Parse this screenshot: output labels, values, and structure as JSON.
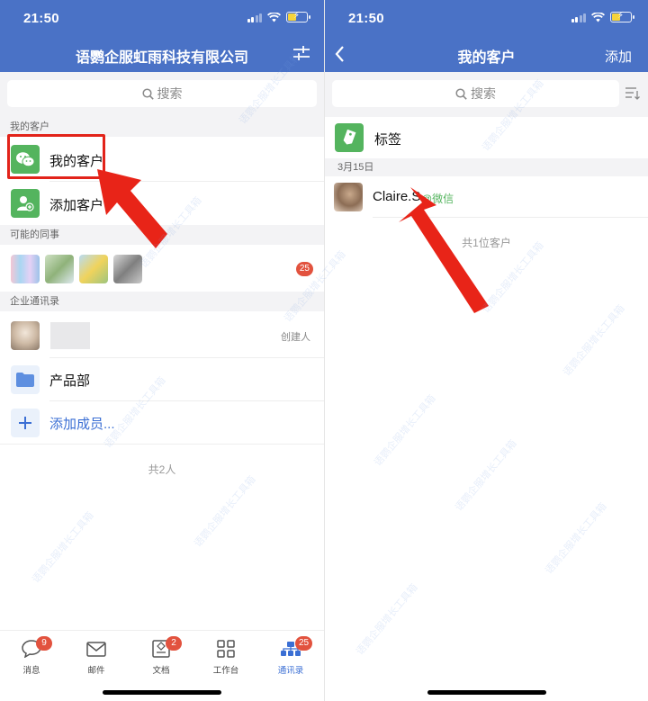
{
  "left": {
    "status_time": "21:50",
    "title": "语鹦企服虹雨科技有限公司",
    "search_placeholder": "搜索",
    "section_my_customers": "我的客户",
    "item_my_customers": "我的客户",
    "item_add_customer": "添加客户",
    "section_colleagues": "可能的同事",
    "colleagues_badge": "25",
    "section_directory": "企业通讯录",
    "creator_label": "创建人",
    "dept_product": "产品部",
    "add_member": "添加成员...",
    "total": "共2人"
  },
  "right": {
    "status_time": "21:50",
    "title": "我的客户",
    "add_action": "添加",
    "search_placeholder": "搜索",
    "tag_item": "标签",
    "date_header": "3月15日",
    "customer_name": "Claire.S",
    "customer_source": "@微信",
    "total": "共1位客户"
  },
  "tabbar": {
    "tabs": [
      {
        "label": "消息",
        "badge": "9"
      },
      {
        "label": "邮件",
        "badge": ""
      },
      {
        "label": "文档",
        "badge": "2"
      },
      {
        "label": "工作台",
        "badge": ""
      },
      {
        "label": "通讯录",
        "badge": "25"
      }
    ]
  },
  "watermark_text": "语鹦企服增长工具箱",
  "colors": {
    "header": "#4A72C6",
    "green": "#54B45E",
    "accent": "#3B6FD4",
    "badge": "#E2523E",
    "annotation": "#E2231A"
  },
  "icons": [
    "search-icon",
    "filter-icon",
    "back-icon",
    "sort-icon",
    "wechat-icon",
    "add-person-icon",
    "tag-icon",
    "folder-icon",
    "plus-icon"
  ]
}
